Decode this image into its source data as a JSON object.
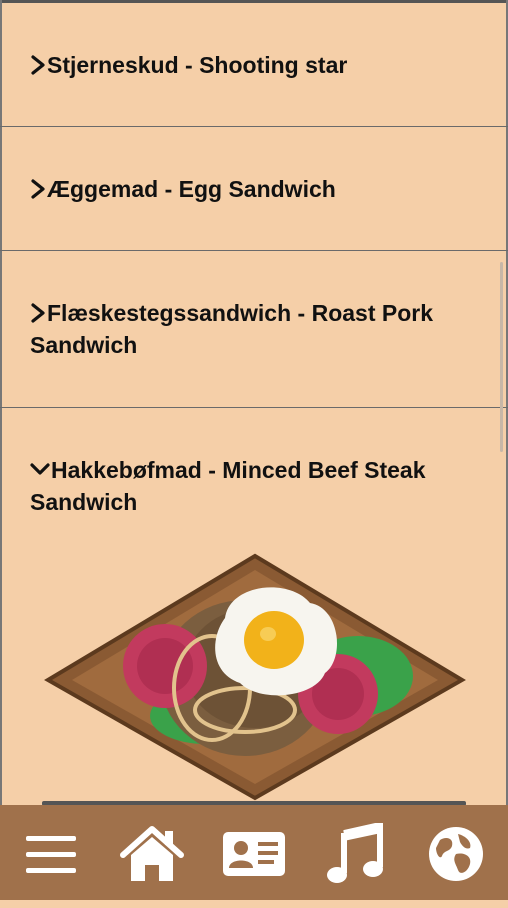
{
  "menu_items": [
    {
      "label": "Stjerneskud - Shooting star",
      "expanded": false
    },
    {
      "label": "Æggemad - Egg Sandwich",
      "expanded": false
    },
    {
      "label": "Flæskestegssandwich - Roast Pork Sandwich",
      "expanded": false
    },
    {
      "label": "Hakkebøfmad - Minced Beef Steak Sandwich",
      "expanded": true
    }
  ],
  "colors": {
    "background": "#f5cfa8",
    "nav_bar": "#a0714b",
    "nav_icon": "#ffffff"
  },
  "bottom_nav": [
    {
      "icon": "menu-icon"
    },
    {
      "icon": "home-icon"
    },
    {
      "icon": "contact-card-icon"
    },
    {
      "icon": "music-icon"
    },
    {
      "icon": "globe-icon"
    }
  ]
}
